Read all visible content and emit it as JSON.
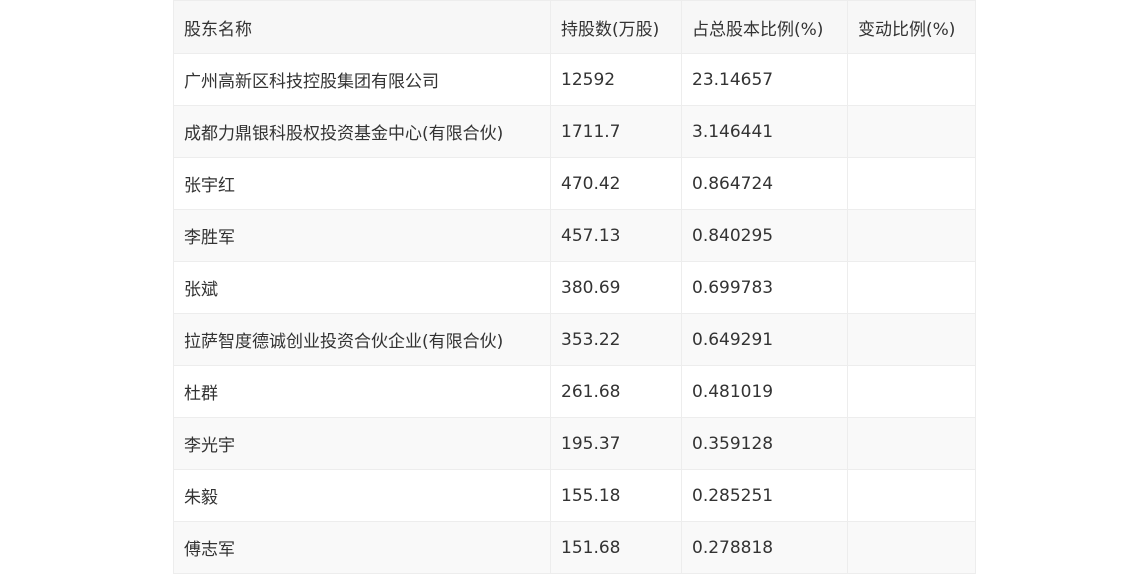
{
  "table": {
    "headers": [
      "股东名称",
      "持股数(万股)",
      "占总股本比例(%)",
      "变动比例(%)"
    ],
    "rows": [
      [
        "广州高新区科技控股集团有限公司",
        "12592",
        "23.14657",
        ""
      ],
      [
        "成都力鼎银科股权投资基金中心(有限合伙)",
        "1711.7",
        "3.146441",
        ""
      ],
      [
        "张宇红",
        "470.42",
        "0.864724",
        ""
      ],
      [
        "李胜军",
        "457.13",
        "0.840295",
        ""
      ],
      [
        "张斌",
        "380.69",
        "0.699783",
        ""
      ],
      [
        "拉萨智度德诚创业投资合伙企业(有限合伙)",
        "353.22",
        "0.649291",
        ""
      ],
      [
        "杜群",
        "261.68",
        "0.481019",
        ""
      ],
      [
        "李光宇",
        "195.37",
        "0.359128",
        ""
      ],
      [
        "朱毅",
        "155.18",
        "0.285251",
        ""
      ],
      [
        "傅志军",
        "151.68",
        "0.278818",
        ""
      ]
    ]
  }
}
